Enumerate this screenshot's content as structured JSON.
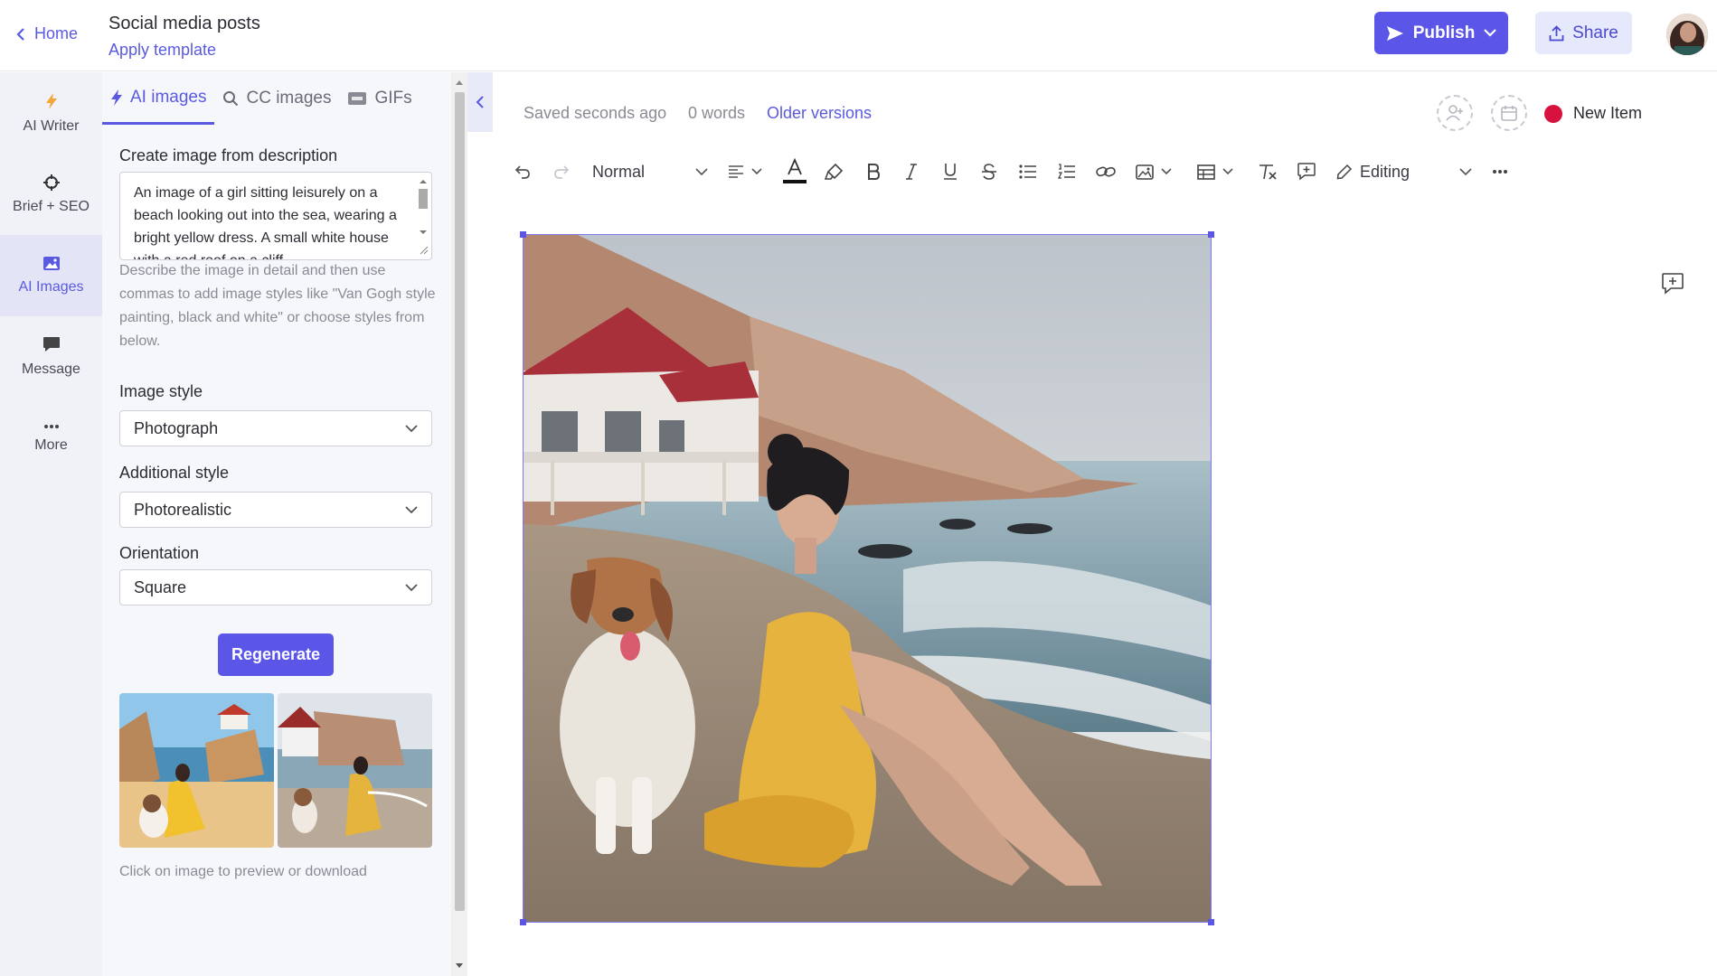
{
  "header": {
    "home_label": "Home",
    "title": "Social media posts",
    "apply_template": "Apply template",
    "publish_label": "Publish",
    "share_label": "Share"
  },
  "rail": {
    "items": [
      {
        "label": "AI Writer",
        "icon": "bolt-icon"
      },
      {
        "label": "Brief + SEO",
        "icon": "crosshair-icon"
      },
      {
        "label": "AI Images",
        "icon": "image-icon",
        "active": true
      },
      {
        "label": "Message",
        "icon": "message-icon"
      },
      {
        "label": "More",
        "icon": "ellipsis-icon"
      }
    ]
  },
  "panel": {
    "tabs": [
      {
        "label": "AI images",
        "active": true
      },
      {
        "label": "CC images"
      },
      {
        "label": "GIFs"
      }
    ],
    "create_label": "Create image from description",
    "description_value": "An image of a girl sitting leisurely on a beach looking out into the sea, wearing a bright yellow dress. A small white house with a red roof on a cliff",
    "hint": "Describe the image in detail and then use commas to add image styles like \"Van Gogh style painting, black and white\" or choose styles from below.",
    "image_style_label": "Image style",
    "image_style_value": "Photograph",
    "additional_style_label": "Additional style",
    "additional_style_value": "Photorealistic",
    "orientation_label": "Orientation",
    "orientation_value": "Square",
    "regenerate_label": "Regenerate",
    "thumb_hint": "Click on image to preview or download"
  },
  "editor": {
    "saved_status": "Saved seconds ago",
    "word_count": "0 words",
    "older_versions": "Older versions",
    "new_item_label": "New Item",
    "paragraph_style": "Normal",
    "mode": "Editing"
  },
  "colors": {
    "accent": "#5b55e8",
    "status_dot": "#d8123f"
  }
}
